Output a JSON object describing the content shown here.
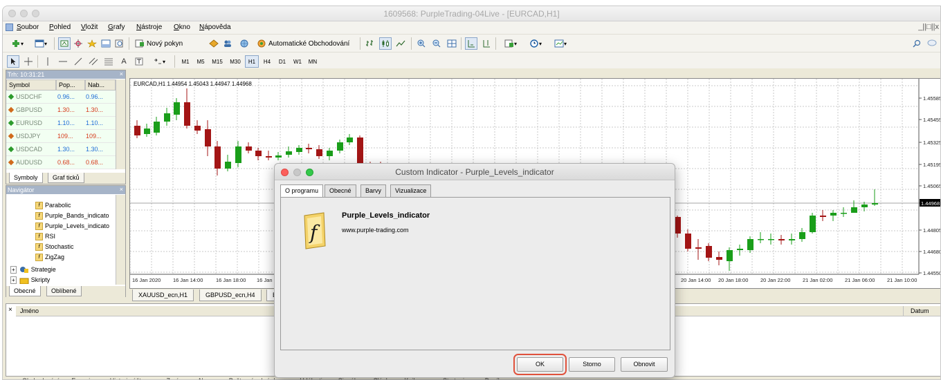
{
  "window": {
    "title": "1609568: PurpleTrading-04Live - [EURCAD,H1]"
  },
  "menu": [
    "Soubor",
    "Pohled",
    "Vložit",
    "Grafy",
    "Nástroje",
    "Okno",
    "Nápověda"
  ],
  "toolbar1": {
    "new_order": "Nový pokyn",
    "auto_trading": "Automatické Obchodování"
  },
  "timeframes": [
    "M1",
    "M5",
    "M15",
    "M30",
    "H1",
    "H4",
    "D1",
    "W1",
    "MN"
  ],
  "active_timeframe": "H1",
  "market_watch": {
    "header": "Trh: 10:31:21",
    "columns": [
      "Symbol",
      "Pop...",
      "Nab..."
    ],
    "rows": [
      {
        "symbol": "USDCHF",
        "bid": "0.96...",
        "ask": "0.96...",
        "dir": "up"
      },
      {
        "symbol": "GBPUSD",
        "bid": "1.30...",
        "ask": "1.30...",
        "dir": "down"
      },
      {
        "symbol": "EURUSD",
        "bid": "1.10...",
        "ask": "1.10...",
        "dir": "up"
      },
      {
        "symbol": "USDJPY",
        "bid": "109...",
        "ask": "109...",
        "dir": "down"
      },
      {
        "symbol": "USDCAD",
        "bid": "1.30...",
        "ask": "1.30...",
        "dir": "up"
      },
      {
        "symbol": "AUDUSD",
        "bid": "0.68...",
        "ask": "0.68...",
        "dir": "down"
      }
    ],
    "tabs": [
      "Symboly",
      "Graf ticků"
    ]
  },
  "navigator": {
    "header": "Navigátor",
    "items": [
      "Parabolic",
      "Purple_Bands_indicato",
      "Purple_Levels_indicato",
      "RSI",
      "Stochastic",
      "ZigZag"
    ],
    "folders": [
      "Strategie",
      "Skripty"
    ],
    "tabs": [
      "Obecné",
      "Oblíbené"
    ]
  },
  "chart": {
    "info": "EURCAD,H1  1.44954 1.45043 1.44947 1.44968",
    "price_labels": [
      "1.45585",
      "1.45455",
      "1.45325",
      "1.45195",
      "1.45065",
      "1.44968",
      "1.44805",
      "1.44680",
      "1.44550"
    ],
    "time_labels_left": [
      "16 Jan 2020",
      "16 Jan 14:00",
      "16 Jan 18:00",
      "16 Jan 2"
    ],
    "time_labels_right": [
      "20 Jan 14:00",
      "20 Jan 18:00",
      "20 Jan 22:00",
      "21 Jan 02:00",
      "21 Jan 06:00",
      "21 Jan 10:00"
    ],
    "tabs": [
      "XAUUSD_ecn,H1",
      "GBPUSD_ecn,H4",
      "E"
    ],
    "colors": {
      "bull": "#1a9e1a",
      "bear": "#a31515",
      "current": "#000000"
    }
  },
  "terminal": {
    "column_name": "Jméno",
    "column_date": "Datum",
    "tabs": [
      "Obchodování",
      "Expozice",
      "Historie účtu",
      "Zprávy",
      "Alarmy",
      "Poštovní schránka",
      "Události",
      "Signály",
      "Články",
      "Knihovna",
      "Strategie",
      "Deník"
    ]
  },
  "dialog": {
    "title": "Custom Indicator - Purple_Levels_indicator",
    "tabs": [
      "O programu",
      "Obecné",
      "Barvy",
      "Vizualizace"
    ],
    "indicator_name": "Purple_Levels_indicator",
    "indicator_url": "www.purple-trading.com",
    "buttons": {
      "ok": "OK",
      "cancel": "Storno",
      "reset": "Obnovit"
    }
  }
}
